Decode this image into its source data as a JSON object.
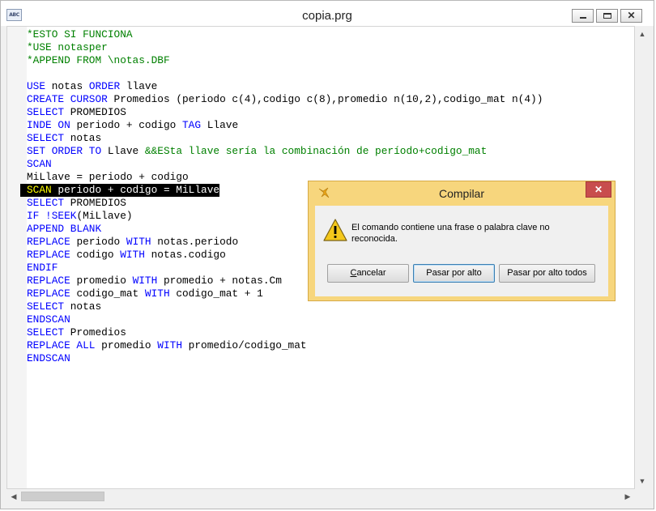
{
  "window": {
    "title": "copia.prg",
    "icon_text": "ABC"
  },
  "colors": {
    "comment": "#008000",
    "keyword": "#0000ff",
    "text": "#000000",
    "highlight_bg": "#000000",
    "highlight_keyword": "#ffff00",
    "highlight_text": "#ffffff"
  },
  "code_lines": [
    [
      {
        "t": "*ESTO SI FUNCIONA",
        "c": "comment"
      }
    ],
    [
      {
        "t": "*USE notasper",
        "c": "comment"
      }
    ],
    [
      {
        "t": "*APPEND FROM \\notas.DBF",
        "c": "comment"
      }
    ],
    [],
    [
      {
        "t": "USE",
        "c": "keyword"
      },
      {
        "t": " notas "
      },
      {
        "t": "ORDER",
        "c": "keyword"
      },
      {
        "t": " llave"
      }
    ],
    [
      {
        "t": "CREATE CURSOR",
        "c": "keyword"
      },
      {
        "t": " Promedios (periodo c(4),codigo c(8),promedio n(10,2),codigo_mat n(4))"
      }
    ],
    [
      {
        "t": "SELECT",
        "c": "keyword"
      },
      {
        "t": " PROMEDIOS"
      }
    ],
    [
      {
        "t": "INDE ON",
        "c": "keyword"
      },
      {
        "t": " periodo + codigo "
      },
      {
        "t": "TAG",
        "c": "keyword"
      },
      {
        "t": " Llave"
      }
    ],
    [
      {
        "t": "SELECT",
        "c": "keyword"
      },
      {
        "t": " notas"
      }
    ],
    [
      {
        "t": "SET ORDER TO",
        "c": "keyword"
      },
      {
        "t": " Llave "
      },
      {
        "t": "&&ESta llave sería la combinación de período+codigo_mat",
        "c": "comment"
      }
    ],
    [
      {
        "t": "SCAN",
        "c": "keyword"
      }
    ],
    [
      {
        "t": "MiLlave = periodo + codigo"
      }
    ],
    {
      "highlight": true,
      "parts": [
        {
          "t": "SCAN",
          "c": "highlight_keyword"
        },
        {
          "t": " periodo + codigo = MiLlave",
          "c": "highlight_text"
        }
      ]
    },
    [
      {
        "t": "SELECT",
        "c": "keyword"
      },
      {
        "t": " PROMEDIOS"
      }
    ],
    [
      {
        "t": "IF !SEEK",
        "c": "keyword"
      },
      {
        "t": "(MiLlave)"
      }
    ],
    [
      {
        "t": "APPEND BLANK",
        "c": "keyword"
      }
    ],
    [
      {
        "t": "REPLACE",
        "c": "keyword"
      },
      {
        "t": " periodo "
      },
      {
        "t": "WITH",
        "c": "keyword"
      },
      {
        "t": " notas.periodo"
      }
    ],
    [
      {
        "t": "REPLACE",
        "c": "keyword"
      },
      {
        "t": " codigo "
      },
      {
        "t": "WITH",
        "c": "keyword"
      },
      {
        "t": " notas.codigo"
      }
    ],
    [
      {
        "t": "ENDIF",
        "c": "keyword"
      }
    ],
    [
      {
        "t": "REPLACE",
        "c": "keyword"
      },
      {
        "t": " promedio "
      },
      {
        "t": "WITH",
        "c": "keyword"
      },
      {
        "t": " promedio + notas.Cm"
      }
    ],
    [
      {
        "t": "REPLACE",
        "c": "keyword"
      },
      {
        "t": " codigo_mat "
      },
      {
        "t": "WITH",
        "c": "keyword"
      },
      {
        "t": " codigo_mat + 1"
      }
    ],
    [
      {
        "t": "SELECT",
        "c": "keyword"
      },
      {
        "t": " notas"
      }
    ],
    [
      {
        "t": "ENDSCAN",
        "c": "keyword"
      }
    ],
    [
      {
        "t": "SELECT",
        "c": "keyword"
      },
      {
        "t": " Promedios"
      }
    ],
    [
      {
        "t": "REPLACE ALL",
        "c": "keyword"
      },
      {
        "t": " promedio "
      },
      {
        "t": "WITH",
        "c": "keyword"
      },
      {
        "t": " promedio/codigo_mat"
      }
    ],
    [
      {
        "t": "ENDSCAN",
        "c": "keyword"
      }
    ]
  ],
  "dialog": {
    "title": "Compilar",
    "close_glyph": "✕",
    "message": "El comando contiene una frase o palabra clave no reconocida.",
    "buttons": {
      "cancel": "Cancelar",
      "ignore": "Pasar por alto",
      "ignore_all": "Pasar por alto todos"
    }
  }
}
